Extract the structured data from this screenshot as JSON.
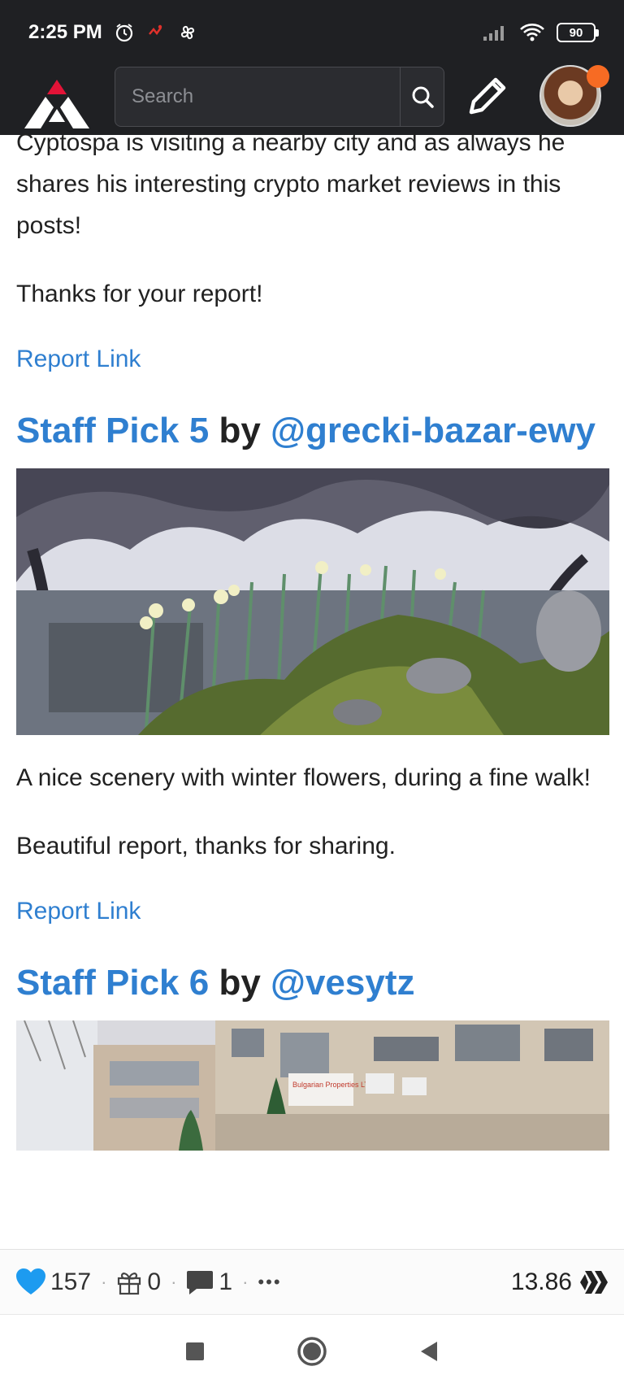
{
  "status_bar": {
    "time": "2:25 PM",
    "battery": "90",
    "icons": [
      "alarm-icon",
      "activity-icon",
      "pinwheel-icon",
      "signal-icon",
      "wifi-icon",
      "battery-icon"
    ]
  },
  "header": {
    "search_placeholder": "Search",
    "icons": [
      "logo-icon",
      "search-icon",
      "pencil-icon",
      "avatar"
    ],
    "accent_color": "#f76b23"
  },
  "post": {
    "intro_paragraph": "Cyptospa is visiting a nearby city and as always he shares his interesting crypto market reviews in this posts!",
    "intro_thanks": "Thanks for your report!",
    "report_link_1": "Report Link",
    "pick5": {
      "title": "Staff Pick 5",
      "by": "by",
      "author": "@grecki-bazar-ewy",
      "description": "A nice scenery with winter flowers, during a fine walk!",
      "thanks": "Beautiful report, thanks for sharing.",
      "report_link": "Report Link"
    },
    "pick6": {
      "title": "Staff Pick 6",
      "by": "by",
      "author": "@vesytz",
      "sign_text": "Bulgarian Properties LTD"
    }
  },
  "action_bar": {
    "likes": "157",
    "gifts": "0",
    "comments": "1",
    "more": "•••",
    "payout": "13.86",
    "like_color": "#1d9bf0"
  },
  "nav_bar": {
    "icons": [
      "recents-icon",
      "home-icon",
      "back-icon"
    ]
  }
}
